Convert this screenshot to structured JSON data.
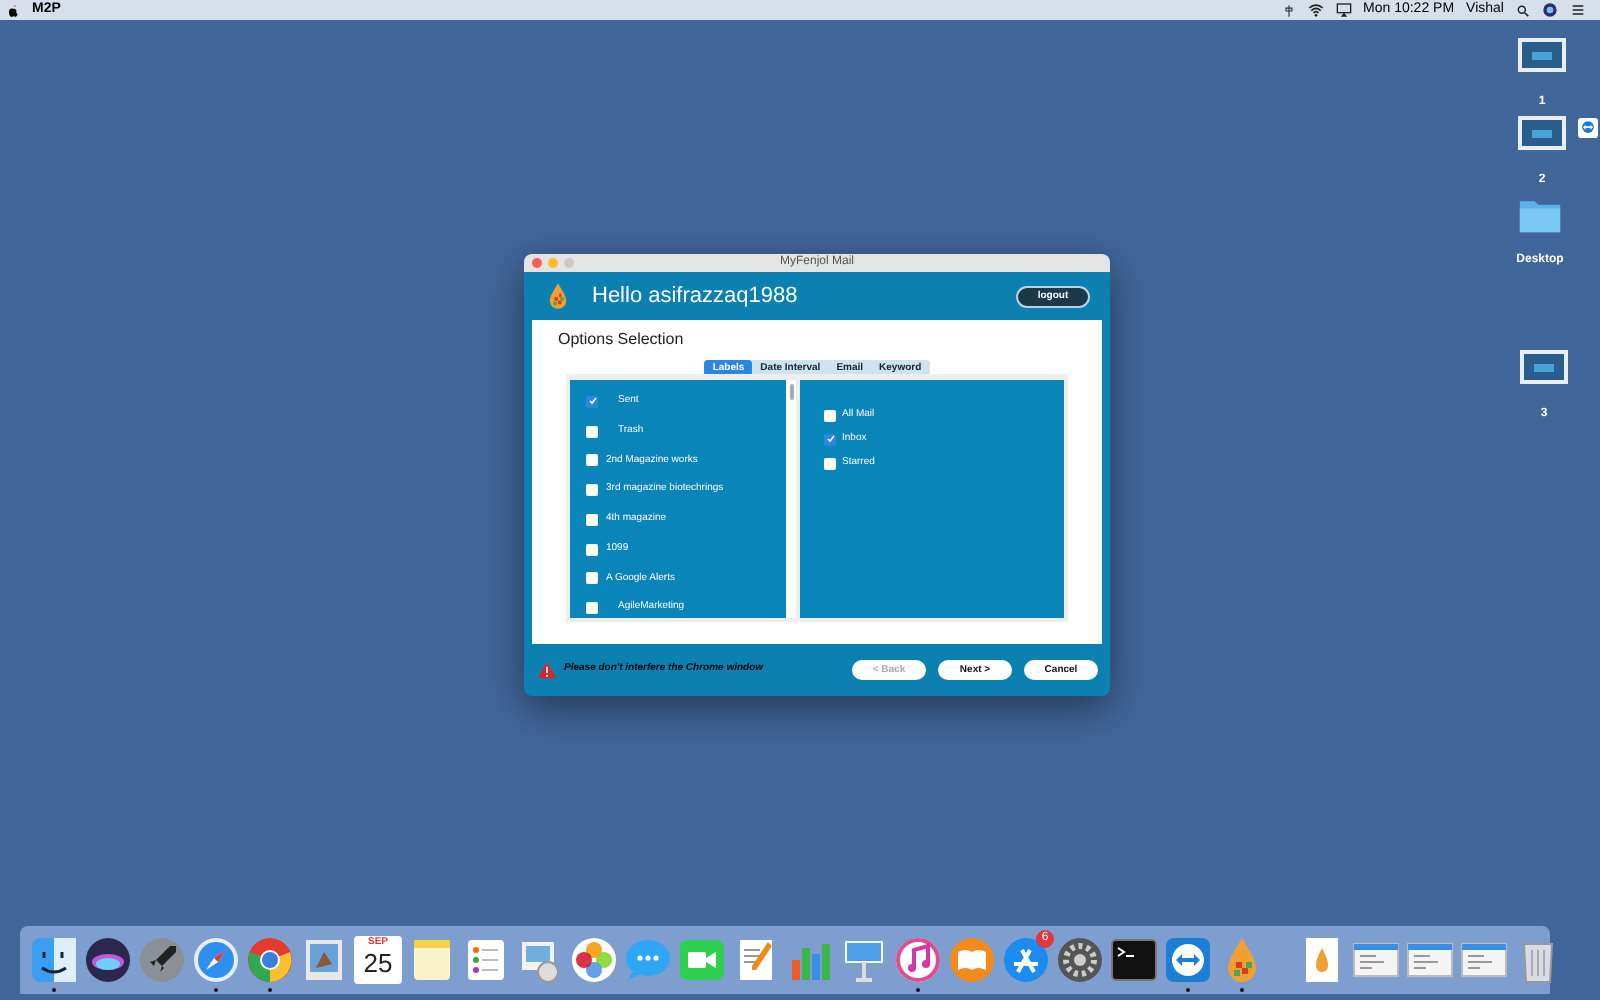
{
  "menu_bar": {
    "app_name": "M2P",
    "clock": "Mon 10:22 PM",
    "user": "Vishal"
  },
  "desktop": {
    "spaces": [
      {
        "label": "1"
      },
      {
        "label": "2"
      },
      {
        "label": "3"
      }
    ],
    "folder": {
      "label": "Desktop"
    }
  },
  "window": {
    "title": "MyFenjol Mail",
    "greeting": "Hello asifrazzaq1988",
    "logout_button": "logout",
    "section_title": "Options Selection",
    "tabs": [
      {
        "label": "Labels",
        "selected": true
      },
      {
        "label": "Date Interval",
        "selected": false
      },
      {
        "label": "Email",
        "selected": false
      },
      {
        "label": "Keyword",
        "selected": false
      }
    ],
    "labels": [
      {
        "label": "Sent",
        "checked": true
      },
      {
        "label": "Trash",
        "checked": false
      },
      {
        "label": "2nd Magazine works",
        "checked": false
      },
      {
        "label": "3rd magazine biotechrings",
        "checked": false
      },
      {
        "label": "4th magazine",
        "checked": false
      },
      {
        "label": "1099",
        "checked": false
      },
      {
        "label": "A Google Alerts",
        "checked": false
      },
      {
        "label": "AgileMarketing",
        "checked": false
      }
    ],
    "folders": [
      {
        "label": "All Mail",
        "checked": false
      },
      {
        "label": "Inbox",
        "checked": true
      },
      {
        "label": "Starred",
        "checked": false
      }
    ],
    "warning": "Please don't interfere the Chrome window",
    "buttons": [
      {
        "label": "< Back",
        "disabled": true
      },
      {
        "label": "Next >",
        "disabled": false
      },
      {
        "label": "Cancel",
        "disabled": false
      }
    ]
  },
  "dock": {
    "items": [
      {
        "kind": "finder",
        "running": true
      },
      {
        "kind": "siri",
        "running": false
      },
      {
        "kind": "launchpad",
        "running": false
      },
      {
        "kind": "safari",
        "running": true
      },
      {
        "kind": "chrome",
        "running": true
      },
      {
        "kind": "preview",
        "running": false
      },
      {
        "kind": "calendar",
        "running": false,
        "month": "SEP",
        "day": "25"
      },
      {
        "kind": "notes",
        "running": false
      },
      {
        "kind": "reminders",
        "running": false
      },
      {
        "kind": "viewer",
        "running": false
      },
      {
        "kind": "photos",
        "running": false
      },
      {
        "kind": "messages",
        "running": false
      },
      {
        "kind": "facetime",
        "running": false
      },
      {
        "kind": "pages",
        "running": false
      },
      {
        "kind": "numbers",
        "running": false
      },
      {
        "kind": "keynote",
        "running": false
      },
      {
        "kind": "itunes",
        "running": true
      },
      {
        "kind": "ibooks",
        "running": false
      },
      {
        "kind": "appstore",
        "running": false,
        "badge": "6"
      },
      {
        "kind": "prefs",
        "running": false
      },
      {
        "kind": "terminal",
        "running": false
      },
      {
        "kind": "teamviewer",
        "running": true
      },
      {
        "kind": "fenjol",
        "running": true
      },
      {
        "kind": "separator"
      },
      {
        "kind": "document"
      },
      {
        "kind": "window"
      },
      {
        "kind": "window"
      },
      {
        "kind": "window"
      },
      {
        "kind": "trash"
      }
    ]
  }
}
